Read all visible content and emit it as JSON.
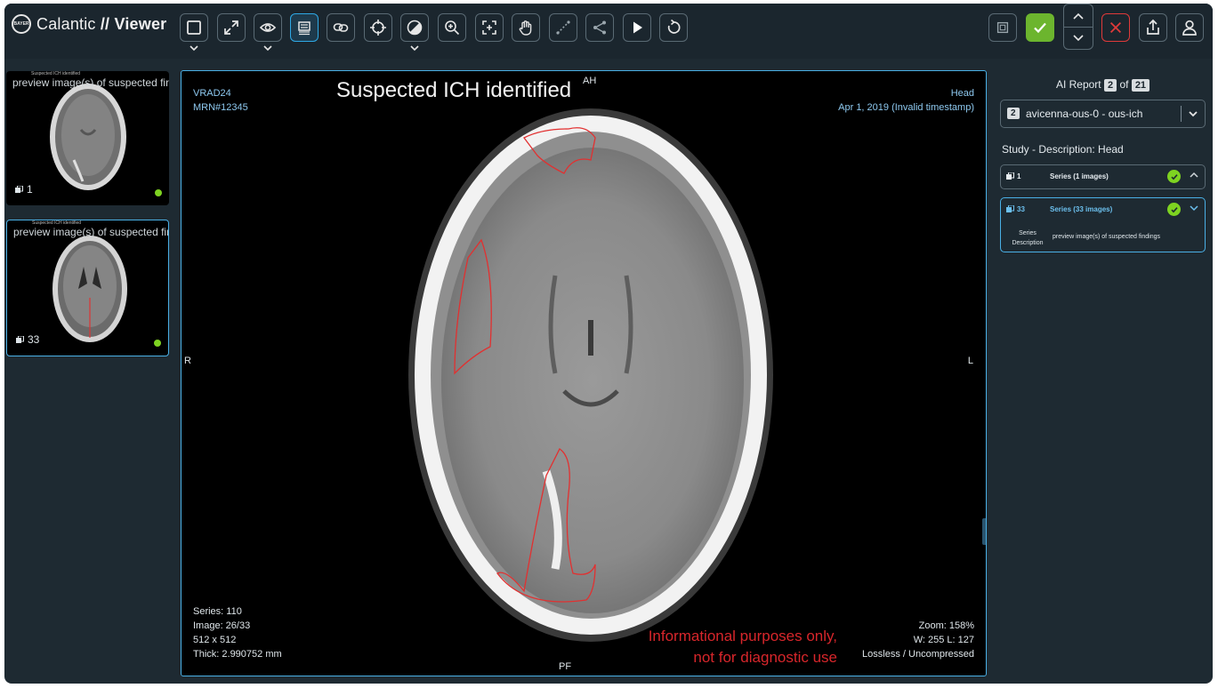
{
  "app": {
    "brand": "Calantic",
    "brand_suffix": "// Viewer",
    "logo_text": "BAYER"
  },
  "toolbar": {
    "tools": [
      {
        "name": "layout",
        "icon": "square-icon",
        "caret": true
      },
      {
        "name": "fullscreen",
        "icon": "expand-icon",
        "caret": false
      },
      {
        "name": "visibility",
        "icon": "eye-icon",
        "caret": true
      },
      {
        "name": "stack-scroll",
        "icon": "stack-icon",
        "caret": false,
        "active": true
      },
      {
        "name": "link",
        "icon": "link-icon",
        "caret": false
      },
      {
        "name": "crosshair",
        "icon": "crosshair-icon",
        "caret": false
      },
      {
        "name": "window-level",
        "icon": "contrast-icon",
        "caret": true
      },
      {
        "name": "zoom",
        "icon": "zoom-icon",
        "caret": false
      },
      {
        "name": "fit",
        "icon": "fit-icon",
        "caret": false
      },
      {
        "name": "pan",
        "icon": "hand-icon",
        "caret": false
      },
      {
        "name": "measure",
        "icon": "ruler-icon",
        "caret": false
      },
      {
        "name": "share",
        "icon": "share-icon",
        "caret": false
      },
      {
        "name": "play",
        "icon": "play-icon",
        "caret": false
      },
      {
        "name": "reset",
        "icon": "reset-icon",
        "caret": false
      }
    ]
  },
  "thumbnails": [
    {
      "label": "preview image(s) of suspected findings",
      "tiny": "Suspected ICH identified",
      "count": "1"
    },
    {
      "label": "preview image(s) of suspected findings",
      "tiny": "Suspected ICH identified",
      "count": "33"
    }
  ],
  "viewport": {
    "headline": "Suspected ICH identified",
    "top_left": [
      "VRAD24",
      "MRN#12345"
    ],
    "top_right": [
      "Head",
      "Apr 1, 2019 (Invalid timestamp)"
    ],
    "bottom_left": [
      "Series: 110",
      "Image: 26/33",
      "512 x 512",
      "Thick: 2.990752 mm"
    ],
    "bottom_right": [
      "Zoom: 158%",
      "W: 255 L: 127",
      "Lossless / Uncompressed"
    ],
    "orient": {
      "top": "AH",
      "bottom": "PF",
      "left": "R",
      "right": "L"
    },
    "disclaimer_1": "Informational purposes only,",
    "disclaimer_2": "not for diagnostic use"
  },
  "report": {
    "title_prefix": "AI Report",
    "current": "2",
    "of": "of",
    "total": "21",
    "dropdown_chip": "2",
    "dropdown_value": "avicenna-ous-0 - ous-ich",
    "study": "Study - Description: Head",
    "series": [
      {
        "num": "1",
        "name": "Series (1 images)"
      },
      {
        "num": "33",
        "name": "Series (33 images)",
        "desc_key_1": "Series",
        "desc_key_2": "Description",
        "desc_value": "preview image(s) of suspected findings"
      }
    ]
  },
  "colors": {
    "accent": "#4ab0e6",
    "success": "#7ed321",
    "danger": "#d8262b",
    "panel": "#1e2a32"
  }
}
